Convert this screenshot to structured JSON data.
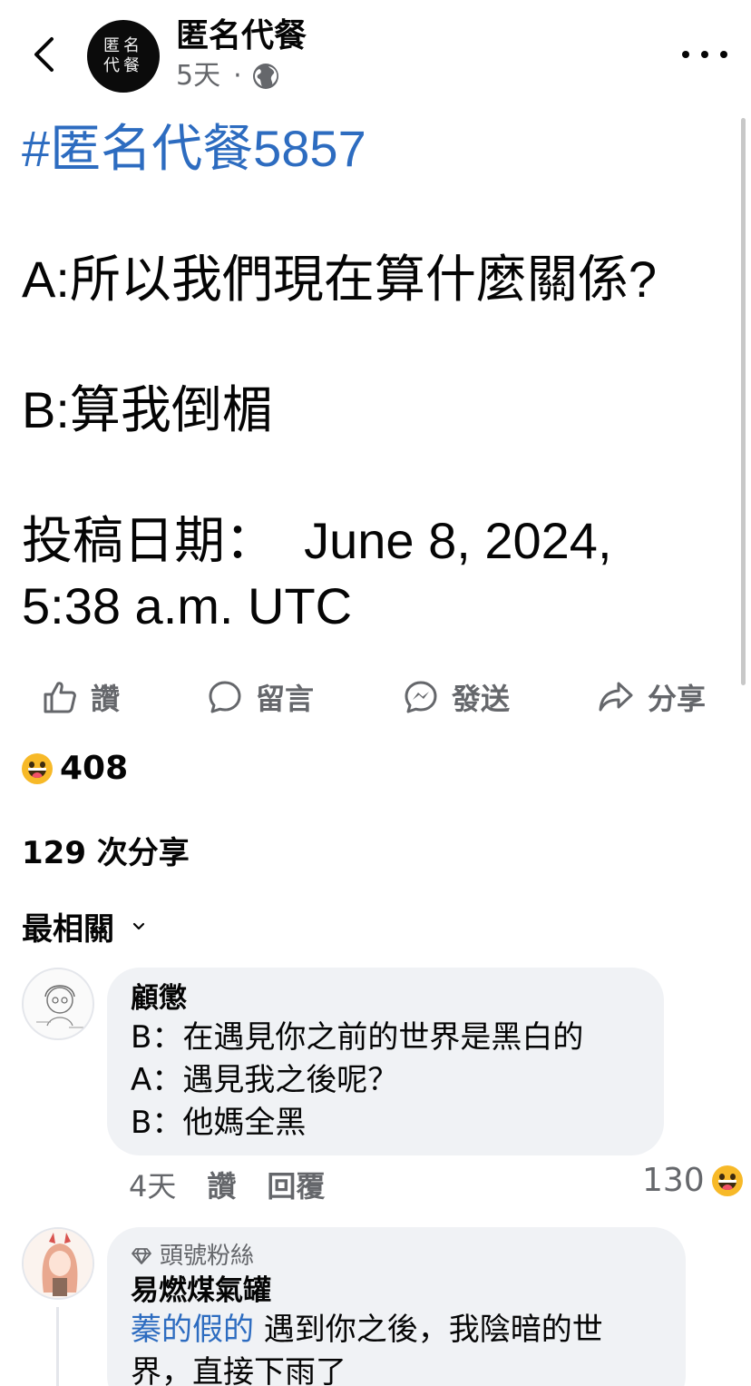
{
  "header": {
    "page_name": "匿名代餐",
    "avatar_text": "匿名代餐",
    "time": "5天",
    "separator": "·",
    "audience_icon": "globe-icon",
    "back_icon": "chevron-left-icon",
    "more_icon": "more-horizontal-icon"
  },
  "post": {
    "hashtag": "#匿名代餐5857",
    "line_a": "A:所以我們現在算什麼關係?",
    "line_b": "B:算我倒楣",
    "date_line1": "投稿日期：  June 8, 2024,",
    "date_line2": "5:38 a.m. UTC"
  },
  "actions": {
    "like": "讚",
    "comment": "留言",
    "send": "發送",
    "share": "分享"
  },
  "reactions": {
    "type": "haha",
    "count": "408"
  },
  "shares": "129 次分享",
  "sort": {
    "label": "最相關"
  },
  "comments": [
    {
      "author": "顧懲",
      "lines": "B：在遇見你之前的世界是黑白的\nA：遇見我之後呢？\nB：他媽全黑",
      "time": "4天",
      "like": "讚",
      "reply": "回覆",
      "reaction_count": "130"
    },
    {
      "badge": "頭號粉絲",
      "author": "易燃煤氣罐",
      "mention": "蓁的假的",
      "text": " 遇到你之後，我陰暗的世界，直接下雨了"
    }
  ],
  "colors": {
    "link": "#2d6cc0",
    "secondary_text": "#65676b",
    "bubble": "#f0f2f5",
    "emoji": "#f7b928"
  }
}
